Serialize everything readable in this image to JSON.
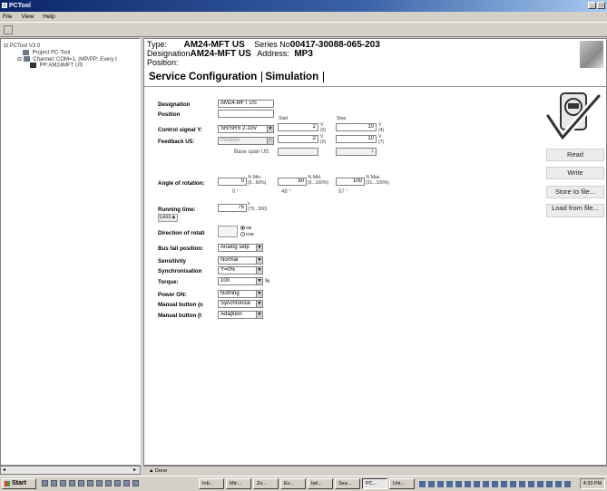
{
  "window": {
    "title": "PCTool"
  },
  "menu": [
    "File",
    "View",
    "Help"
  ],
  "tree": {
    "root": "PCTool V3.0",
    "project": "Project PC-Tool",
    "channel": "Channel: COM=1, (MP/PP: Every t",
    "device": "PP:AM24MFT US"
  },
  "header": {
    "type_label": "Type:",
    "type_value": "AM24-MFT US",
    "series_label": "Series No",
    "series_value": "00417-30088-065-203",
    "designation_label": "Designation",
    "designation_value": "AM24-MFT US",
    "address_label": "Address:",
    "address_value": "MP3",
    "position_label": "Position:"
  },
  "tabs": [
    "Service",
    "Configuration",
    "Simulation"
  ],
  "form": {
    "designation_label": "Designation",
    "designation_value": "AM24-MFT US",
    "position_label": "Position",
    "position_value": "",
    "start_label": "Start",
    "stop_label": "Stop",
    "control_signal_label": "Control signal Y:",
    "control_signal_value": "SR/SRS 2-10V",
    "control_start_value": "2",
    "control_start_unit": "V",
    "control_start_sub": "(0)",
    "control_stop_value": "10",
    "control_stop_unit": "V",
    "control_stop_sub": "(4)",
    "feedback_label": "Feedback U5:",
    "feedback_value": "Position",
    "feedback_start_value": "2",
    "feedback_start_unit": "V",
    "feedback_start_sub": "(0)",
    "feedback_stop_value": "10",
    "feedback_stop_unit": "V",
    "feedback_stop_sub": "(7)",
    "base_span_label": "Base span U5:",
    "base_span_value": "1",
    "angle_label": "Angle of rotation:",
    "angle_min_value": "0",
    "angle_min_text": "% Min.",
    "angle_min_sub": "(0...60%)",
    "angle_mid_value": "50",
    "angle_mid_text": "% Mid.",
    "angle_mid_sub": "(0...100%)",
    "angle_max_value": "100",
    "angle_max_text": "% Max.",
    "angle_max_sub": "(31...100%)",
    "deg_0": "0 °",
    "deg_48": "48 °",
    "deg_97": "97 °",
    "running_time_label": "Running time:",
    "running_time_value": "75",
    "running_time_unit": "s",
    "running_time_sub": "(75...300)",
    "less_button": "Less▲",
    "direction_label": "Direction of rotati",
    "direction_cw": "cw",
    "direction_ccw": "ccw",
    "bus_fail_label": "Bus fail position:",
    "bus_fail_value": "Analog setp",
    "sensitivity_label": "Sensitivity",
    "sensitivity_value": "Normal",
    "synchronisation_label": "Synchronisation",
    "synchronisation_value": "Y=0%",
    "torque_label": "Torque:",
    "torque_value": "100",
    "torque_unit": "%",
    "power_on_label": "Power ON:",
    "power_on_value": "Nothing",
    "manual_button1_label": "Manual button (o",
    "manual_button1_value": "Synchronise",
    "manual_button2_label": "Manual button (t",
    "manual_button2_value": "Adaption"
  },
  "buttons": {
    "read": "Read",
    "write": "Write",
    "store": "Store to file...",
    "load": "Load from file..."
  },
  "status": {
    "text": "Done"
  },
  "taskbar": {
    "start": "Start",
    "tasks": [
      "Inb...",
      "Mic...",
      "Zo...",
      "Ev...",
      "bel...",
      "Sea...",
      "PC...",
      "Unt..."
    ],
    "clock": "4:33 PM"
  }
}
